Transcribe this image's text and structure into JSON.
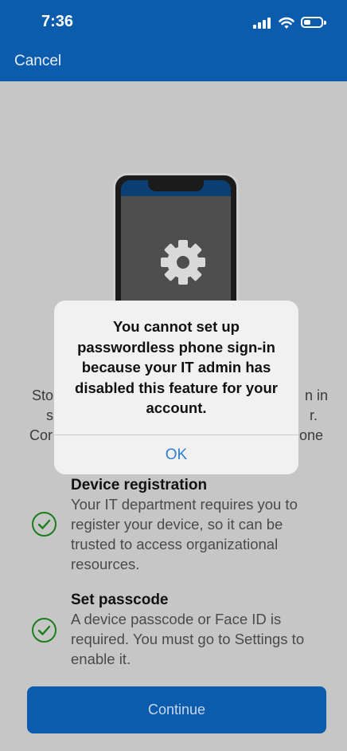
{
  "status_bar": {
    "time": "7:36"
  },
  "header": {
    "cancel_label": "Cancel"
  },
  "background_fragments": {
    "line1_left": "Sto",
    "line1_right": "n in",
    "line2_left": "s",
    "line2_right": "r.",
    "line3_left": "Cor",
    "line3_right": "one"
  },
  "features": [
    {
      "title": "Device registration",
      "description": "Your IT department requires you to register your device, so it can be trusted to access organizational resources."
    },
    {
      "title": "Set passcode",
      "description": "A device passcode or Face ID is required. You must go to Settings to enable it."
    }
  ],
  "continue_label": "Continue",
  "alert": {
    "message": "You cannot set up passwordless phone sign-in because your IT admin has disabled this feature for your account.",
    "ok_label": "OK"
  },
  "colors": {
    "brand_blue": "#0b5cad",
    "check_green": "#1a7e1a",
    "alert_action_blue": "#2f7fd0"
  }
}
